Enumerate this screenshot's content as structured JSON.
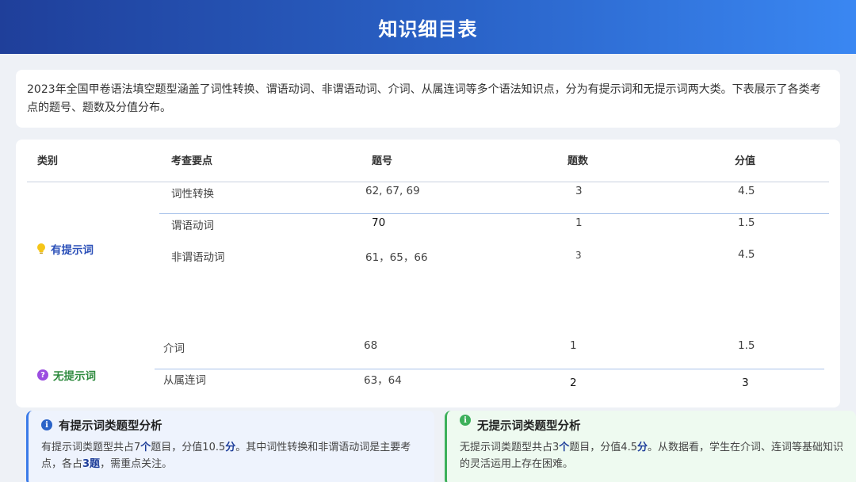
{
  "header": {
    "title": "知识细目表"
  },
  "intro": {
    "text": "2023年全国甲卷语法填空题型涵盖了词性转换、谓语动词、非谓语动词、介词、从属连词等多个语法知识点，分为有提示词和无提示词两大类。下表展示了各类考点的题号、题数及分值分布。"
  },
  "table": {
    "headers": [
      "类别",
      "考查要点",
      "题号",
      "题数",
      "分值"
    ],
    "groups": [
      {
        "category": "有提示词",
        "icon": "lightbulb-icon",
        "color": "#2a4fb8",
        "rows": [
          {
            "point": "词性转换",
            "numbers": "62, 67, 69",
            "count": "3",
            "score": "4.5"
          },
          {
            "point": "谓语动词",
            "numbers": "70",
            "count": "1",
            "score": "1.5"
          },
          {
            "point": "非谓语动词",
            "numbers": "61，65，66",
            "count": "3",
            "score": "4.5"
          }
        ]
      },
      {
        "category": "无提示词",
        "icon": "question-icon",
        "color": "#2e8a3e",
        "rows": [
          {
            "point": "介词",
            "numbers": "68",
            "count": "1",
            "score": "1.5"
          },
          {
            "point": "从属连词",
            "numbers": "63，64",
            "count": "2",
            "score": "3"
          }
        ]
      }
    ]
  },
  "analysis": {
    "hint": {
      "title": "有提示词类题型分析",
      "icon": "info-icon",
      "p1": "有提示词类题型共占7",
      "u1": "个",
      "p2": "题目，分值10.5",
      "u2": "分",
      "p3": "。其中词性转换和非谓语动词是主要考点，各占",
      "u3": "3题",
      "p4": "，需重点关注。"
    },
    "nohint": {
      "title": "无提示词类题型分析",
      "icon": "info-icon",
      "p1": "无提示词类题型共占3",
      "u1": "个",
      "p2": "题目，分值4.5",
      "u2": "分",
      "p3": "。从数据看，学生在介词、连词等基础知识的灵活运用上存在困难。"
    }
  },
  "colors": {
    "accent": "#2a63c8",
    "green": "#3cb05a",
    "purple": "#9b4de0"
  }
}
